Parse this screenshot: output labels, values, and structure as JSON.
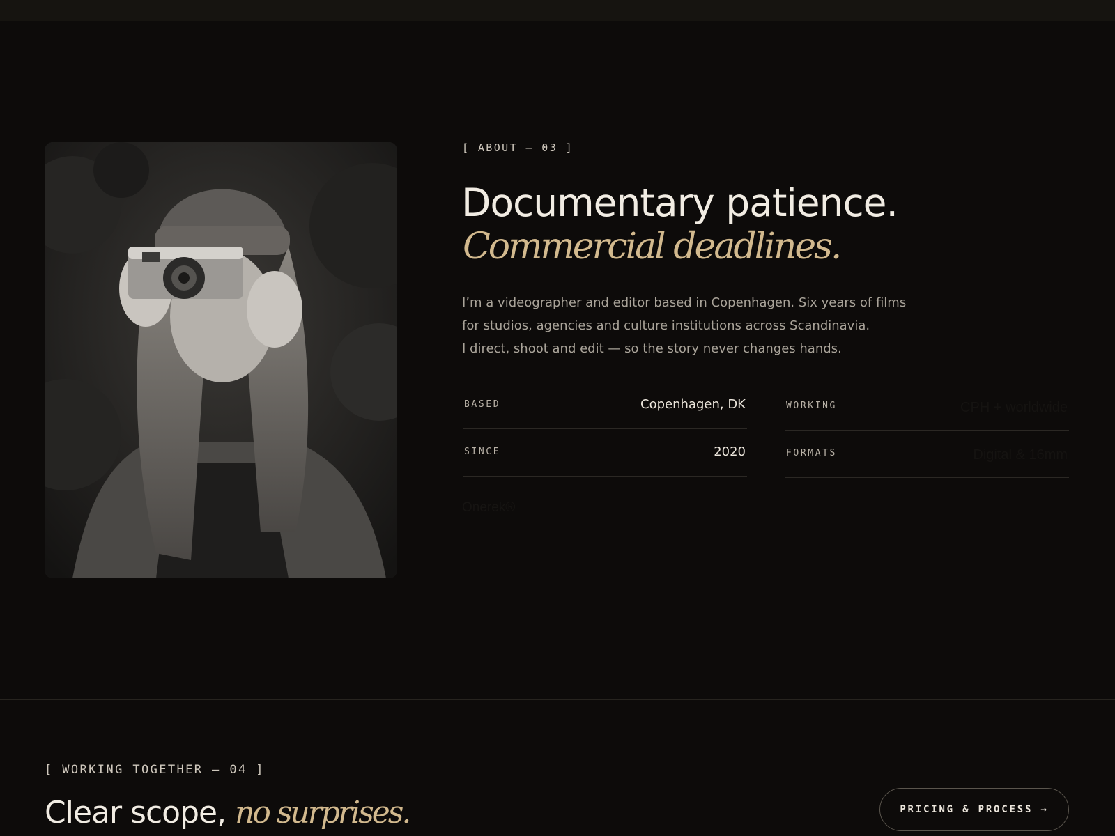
{
  "about": {
    "kicker": "[ ABOUT — 03 ]",
    "headline": "Documentary patience.",
    "headline_accent": "Commercial deadlines.",
    "bio": [
      "I’m a videographer and editor based in Copenhagen. Six years of films",
      "for studios, agencies and culture institutions across Scandinavia.",
      "I direct, shoot and edit — so the story never changes hands."
    ],
    "facts": [
      {
        "label": "BASED",
        "value": "Copenhagen, DK"
      },
      {
        "label": "WORKING",
        "value": "CPH + worldwide"
      },
      {
        "label": "SINCE",
        "value": "2020"
      },
      {
        "label": "FORMATS",
        "value": "Digital & 16mm"
      }
    ],
    "brandmark": "Onerek®",
    "photo_icon": "portrait-photo-icon"
  },
  "working": {
    "kicker": "[ WORKING TOGETHER — 04 ]",
    "headline": "Clear scope,",
    "headline_accent": "no surprises.",
    "cta_label": "PRICING & PROCESS →"
  },
  "colors": {
    "background": "#0d0b0a",
    "accent": "#d2b98e",
    "text": "#ece6dc",
    "muted": "#a9a399"
  }
}
